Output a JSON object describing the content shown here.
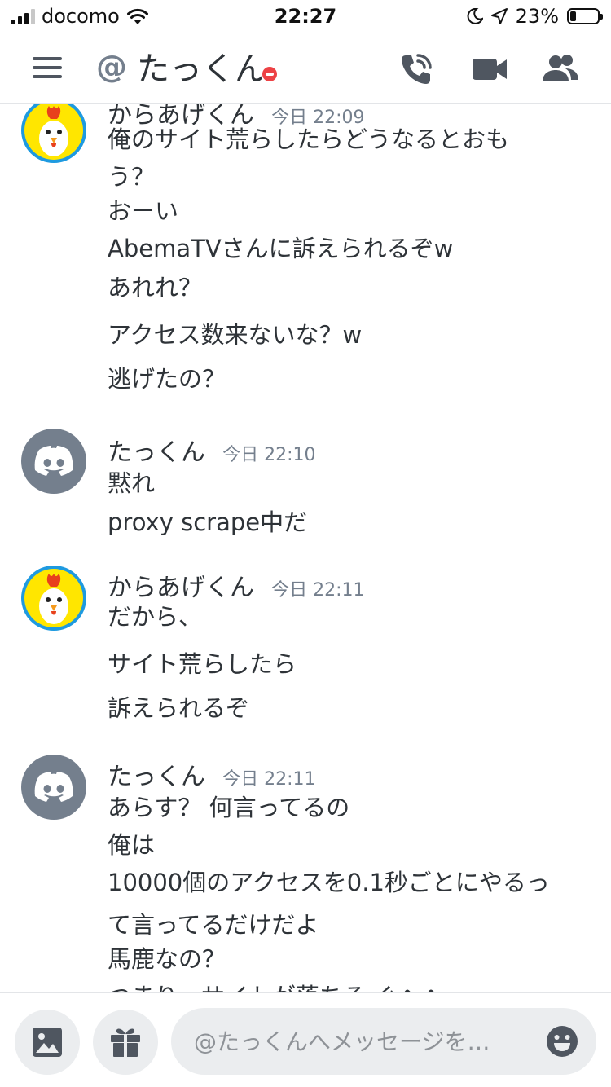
{
  "status_bar": {
    "carrier": "docomo",
    "time": "22:27",
    "battery_percent": "23%",
    "battery_level": 0.23
  },
  "header": {
    "at_symbol": "@",
    "title": "たっくん",
    "status": "dnd",
    "status_color": "#ed4245"
  },
  "icons": {
    "menu": "hamburger-menu-icon",
    "call": "phone-call-icon",
    "video": "video-camera-icon",
    "members": "members-icon",
    "image": "image-icon",
    "gift": "gift-icon",
    "emoji": "emoji-icon"
  },
  "messages": [
    {
      "author": "からあげくん",
      "time": "今日 22:09",
      "avatar": "chick",
      "lines": [
        "俺のサイト荒らしたらどうなるとおも",
        "う？",
        "おーい",
        "AbemaTVさんに訴えられるぞw",
        "あれれ？",
        "アクセス数来ないな？w",
        "逃げたの？"
      ]
    },
    {
      "author": "たっくん",
      "time": "今日 22:10",
      "avatar": "discord",
      "lines": [
        "黙れ",
        "proxy scrape中だ"
      ]
    },
    {
      "author": "からあげくん",
      "time": "今日 22:11",
      "avatar": "chick",
      "lines": [
        "だから、",
        "サイト荒らしたら",
        "訴えられるぞ"
      ]
    },
    {
      "author": "たっくん",
      "time": "今日 22:11",
      "avatar": "discord",
      "lines": [
        "あらす？ 何言ってるの",
        "俺は",
        "10000個のアクセスを0.1秒ごとにやるっ",
        "て言ってるだけだよ",
        "馬鹿なの？",
        "つまり、サイトが落ちる ぐへへ"
      ]
    }
  ],
  "composer": {
    "placeholder": "@たっくんへメッセージを…"
  },
  "colors": {
    "accent_gray": "#747f8d",
    "text": "#2e3338",
    "dnd_red": "#ed4245",
    "input_bg": "#ebedef"
  }
}
